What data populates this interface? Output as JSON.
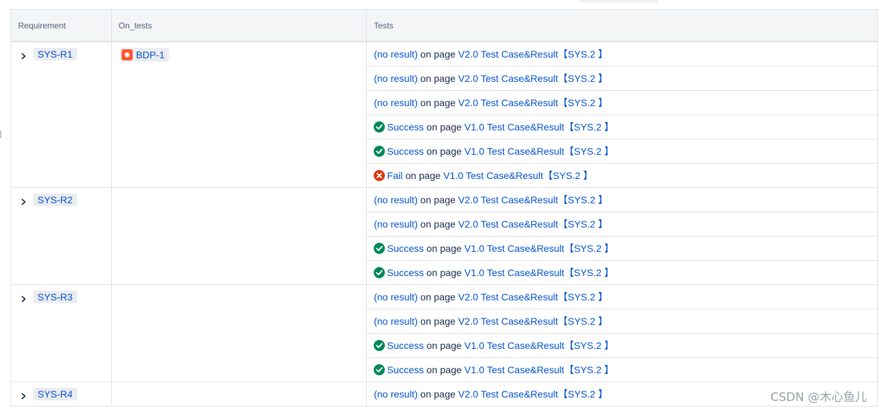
{
  "headers": {
    "requirement": "Requirement",
    "on_tests": "On_tests",
    "tests": "Tests"
  },
  "common": {
    "on_page": "on page"
  },
  "requirements": [
    {
      "id": "SYS-R1",
      "on_tests": "BDP-1",
      "tests": [
        {
          "status": "(no result)",
          "icon": "",
          "page": "V2.0 Test Case&Result【SYS.2 】"
        },
        {
          "status": "(no result)",
          "icon": "",
          "page": "V2.0 Test Case&Result【SYS.2 】"
        },
        {
          "status": "(no result)",
          "icon": "",
          "page": "V2.0 Test Case&Result【SYS.2 】"
        },
        {
          "status": "Success",
          "icon": "check-circle-icon",
          "page": "V1.0 Test Case&Result【SYS.2 】"
        },
        {
          "status": "Success",
          "icon": "check-circle-icon",
          "page": "V1.0 Test Case&Result【SYS.2 】"
        },
        {
          "status": "Fail",
          "icon": "error-circle-icon",
          "page": "V1.0 Test Case&Result【SYS.2 】"
        }
      ]
    },
    {
      "id": "SYS-R2",
      "on_tests": "",
      "tests": [
        {
          "status": "(no result)",
          "icon": "",
          "page": "V2.0 Test Case&Result【SYS.2 】"
        },
        {
          "status": "(no result)",
          "icon": "",
          "page": "V2.0 Test Case&Result【SYS.2 】"
        },
        {
          "status": "Success",
          "icon": "check-circle-icon",
          "page": "V1.0 Test Case&Result【SYS.2 】"
        },
        {
          "status": "Success",
          "icon": "check-circle-icon",
          "page": "V1.0 Test Case&Result【SYS.2 】"
        }
      ]
    },
    {
      "id": "SYS-R3",
      "on_tests": "",
      "tests": [
        {
          "status": "(no result)",
          "icon": "",
          "page": "V2.0 Test Case&Result【SYS.2 】"
        },
        {
          "status": "(no result)",
          "icon": "",
          "page": "V2.0 Test Case&Result【SYS.2 】"
        },
        {
          "status": "Success",
          "icon": "check-circle-icon",
          "page": "V1.0 Test Case&Result【SYS.2 】"
        },
        {
          "status": "Success",
          "icon": "check-circle-icon",
          "page": "V1.0 Test Case&Result【SYS.2 】"
        }
      ]
    },
    {
      "id": "SYS-R4",
      "on_tests": "",
      "tests": [
        {
          "status": "(no result)",
          "icon": "",
          "page": "V2.0 Test Case&Result【SYS.2 】"
        }
      ]
    }
  ],
  "colors": {
    "link": "#0052cc",
    "success": "#00875a",
    "fail": "#de350b",
    "bug": "#ff5630"
  },
  "watermark": "CSDN @木心鱼儿"
}
